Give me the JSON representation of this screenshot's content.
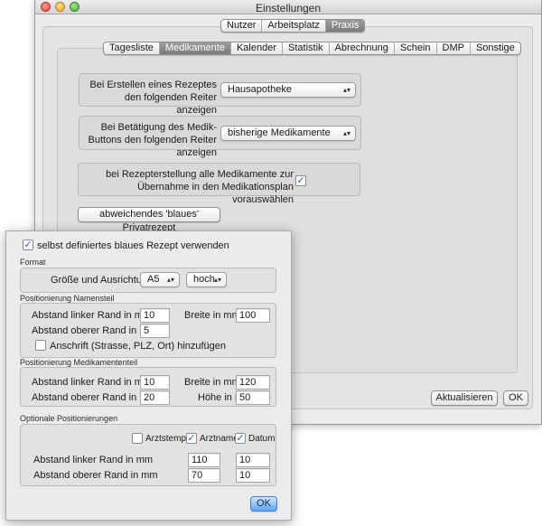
{
  "window": {
    "title": "Einstellungen"
  },
  "top_tabs": [
    {
      "label": "Nutzer",
      "selected": false
    },
    {
      "label": "Arbeitsplatz",
      "selected": false
    },
    {
      "label": "Praxis",
      "selected": true
    }
  ],
  "sub_tabs": [
    {
      "label": "Tagesliste",
      "selected": false
    },
    {
      "label": "Medikamente",
      "selected": true
    },
    {
      "label": "Kalender",
      "selected": false
    },
    {
      "label": "Statistik",
      "selected": false
    },
    {
      "label": "Abrechnung",
      "selected": false
    },
    {
      "label": "Schein",
      "selected": false
    },
    {
      "label": "DMP",
      "selected": false
    },
    {
      "label": "Sonstige",
      "selected": false
    }
  ],
  "medikamente": {
    "rezept_label": "Bei Erstellen eines Rezeptes den folgenden Reiter anzeigen",
    "rezept_value": "Hausapotheke",
    "buttons_label": "Bei Betätigung des Medik-Buttons den folgenden Reiter anzeigen",
    "buttons_value": "bisherige Medikamente",
    "plan_label": "bei Rezepterstellung alle  Medikamente zur Übernahme in den Medikationsplan vorauswählen",
    "plan_checked": true,
    "blue_button_label": "abweichendes 'blaues' Privatrezept"
  },
  "main_buttons": {
    "update_label": "Aktualisieren",
    "ok_label": "OK"
  },
  "popover": {
    "use_custom_label": "selbst definiertes blaues Rezept verwenden",
    "use_custom_checked": true,
    "format": {
      "title": "Format",
      "size_label": "Größe und Ausrichtung",
      "size_value": "A5",
      "orientation_value": "hoch"
    },
    "name_part": {
      "title": "Positionierung Namensteil",
      "left_label": "Abstand linker Rand in mm",
      "left_value": "10",
      "width_label": "Breite in mm",
      "width_value": "100",
      "top_label": "Abstand oberer Rand in mm",
      "top_value": "5",
      "address_label": "Anschrift (Strasse, PLZ, Ort) hinzufügen",
      "address_checked": false
    },
    "med_part": {
      "title": "Positionierung Medikamententeil",
      "left_label": "Abstand linker Rand in mm",
      "left_value": "10",
      "width_label": "Breite in mm",
      "width_value": "120",
      "top_label": "Abstand oberer Rand in mm",
      "top_value": "20",
      "height_label": "Höhe in mm",
      "height_value": "50"
    },
    "optional": {
      "title": "Optionale Positionierungen",
      "arztstempel_label": "Arztstempel",
      "arztstempel_checked": false,
      "arztname_label": "Arztname",
      "arztname_checked": true,
      "datum_label": "Datum",
      "datum_checked": true,
      "left_label": "Abstand linker Rand in mm",
      "top_label": "Abstand oberer Rand in mm",
      "arztname_left": "110",
      "arztname_top": "70",
      "datum_left": "10",
      "datum_top": "10"
    },
    "ok_label": "OK"
  }
}
